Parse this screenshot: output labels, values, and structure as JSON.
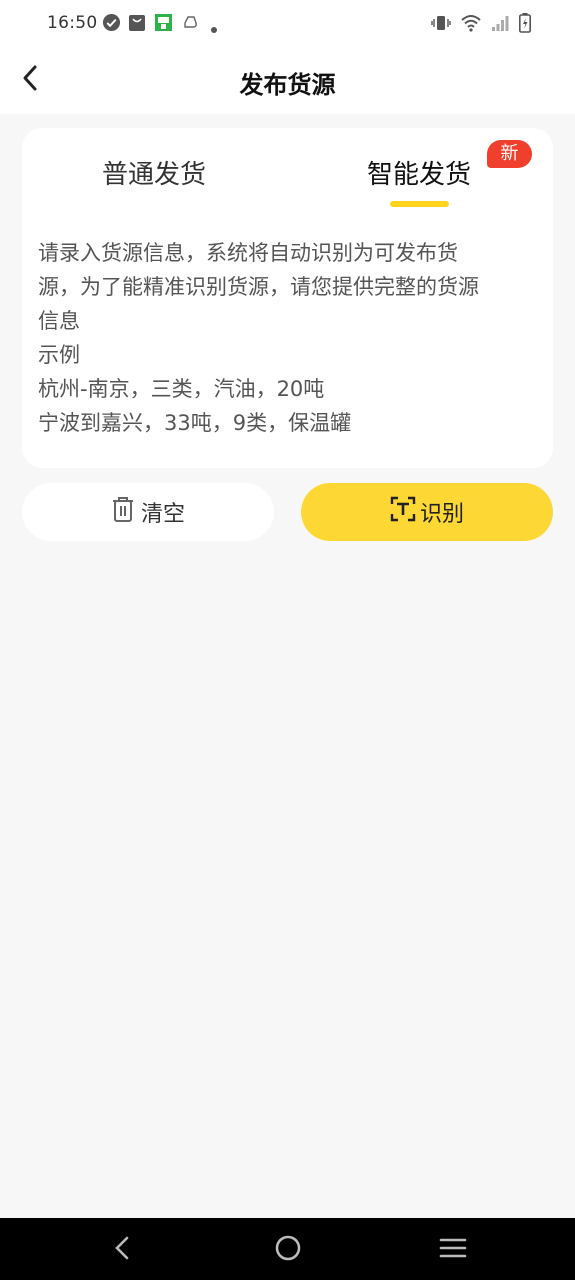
{
  "status_bar": {
    "time": "16:50",
    "left_icons": [
      "check-circle-icon",
      "bag-icon",
      "app-store-icon",
      "cloud-icon",
      "dot-icon"
    ],
    "right_icons": [
      "vibrate-icon",
      "wifi-icon",
      "signal-icon",
      "battery-icon"
    ]
  },
  "header": {
    "title": "发布货源",
    "back_icon": "chevron-left-icon"
  },
  "tabs": [
    {
      "label": "普通发货",
      "active": false
    },
    {
      "label": "智能发货",
      "active": true
    }
  ],
  "badge": {
    "label": "新",
    "color": "#f0402d"
  },
  "instructions": {
    "lines": [
      "请录入货源信息，系统将自动识别为可发布货",
      "源，为了能精准识别货源，请您提供完整的货源",
      "信息",
      "示例",
      "杭州-南京，三类，汽油，20吨",
      "宁波到嘉兴，33吨，9类，保温罐"
    ]
  },
  "actions": {
    "clear_label": "清空",
    "clear_icon": "trash-icon",
    "recognize_label": "识别",
    "recognize_icon": "scan-text-icon"
  },
  "colors": {
    "accent": "#fdd835",
    "tab_indicator": "#ffd51c",
    "badge": "#f0402d",
    "background": "#f7f7f7"
  },
  "nav_bar": {
    "icons": [
      "back-triangle-icon",
      "home-circle-icon",
      "menu-lines-icon"
    ]
  }
}
